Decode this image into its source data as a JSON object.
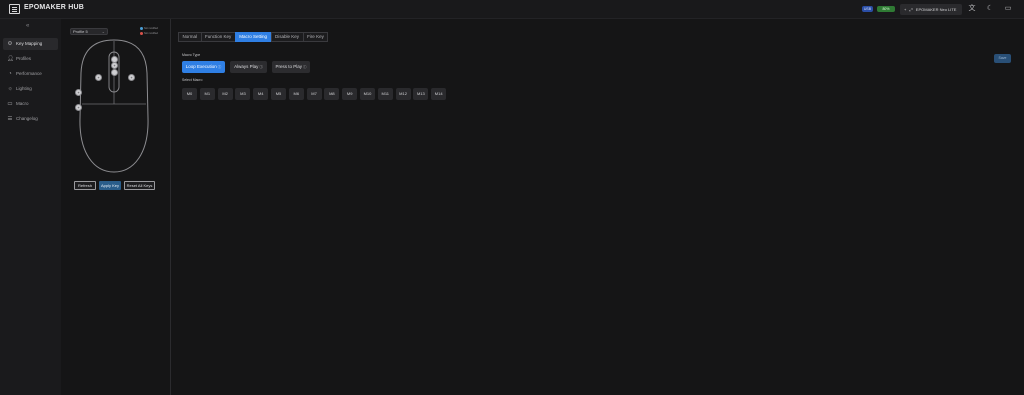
{
  "header": {
    "app_title": "EPOMAKER HUB",
    "usb_badge": "USB",
    "battery_badge": "80%",
    "device_name": "EPOMAKER Neo LITE",
    "icons": [
      "logo-icon",
      "plus-icon",
      "link-icon",
      "language-icon",
      "moon-icon",
      "window-icon"
    ],
    "colors": {
      "usb": "#2b4ea6",
      "battery": "#2f7a34"
    }
  },
  "sidebar": {
    "collapse_icon": "double-chevron-left-icon",
    "items": [
      {
        "label": "Key Mapping",
        "icon": "settings-icon",
        "active": true
      },
      {
        "label": "Profiles",
        "icon": "person-icon",
        "active": false
      },
      {
        "label": "Performance",
        "icon": "gauge-icon",
        "active": false
      },
      {
        "label": "Lighting",
        "icon": "bulb-icon",
        "active": false
      },
      {
        "label": "Macro",
        "icon": "monitor-icon",
        "active": false
      },
      {
        "label": "Changelog",
        "icon": "list-icon",
        "active": false
      }
    ]
  },
  "panel": {
    "profile": "Profile 5",
    "legend": [
      {
        "label": "Not modified",
        "color": "#4a9fd8"
      },
      {
        "label": "Not modified",
        "color": "#d8524a"
      }
    ],
    "buttons": {
      "refresh": "Refresh",
      "apply": "Apply Key",
      "reset": "Reset All Keys"
    }
  },
  "main": {
    "tabs": [
      {
        "label": "Normal",
        "active": false
      },
      {
        "label": "Function Key",
        "active": false
      },
      {
        "label": "Macro Setting",
        "active": true
      },
      {
        "label": "Disable Key",
        "active": false
      },
      {
        "label": "Fire Key",
        "active": false
      }
    ],
    "macro_type_label": "Macro Type",
    "macro_types": [
      {
        "label": "Loop Execution",
        "suffix": "ⓘ",
        "active": true
      },
      {
        "label": "Always Play",
        "suffix": "ⓘ",
        "active": false
      },
      {
        "label": "Press to Play",
        "suffix": "ⓘ",
        "active": false
      }
    ],
    "select_macro_label": "Select Macro",
    "macros": [
      "M0",
      "M1",
      "M2",
      "M3",
      "M4",
      "M5",
      "M6",
      "M7",
      "M8",
      "M9",
      "M10",
      "M11",
      "M12",
      "M13",
      "M14"
    ],
    "save_label": "Save",
    "accent_color": "#2f7fe4"
  }
}
